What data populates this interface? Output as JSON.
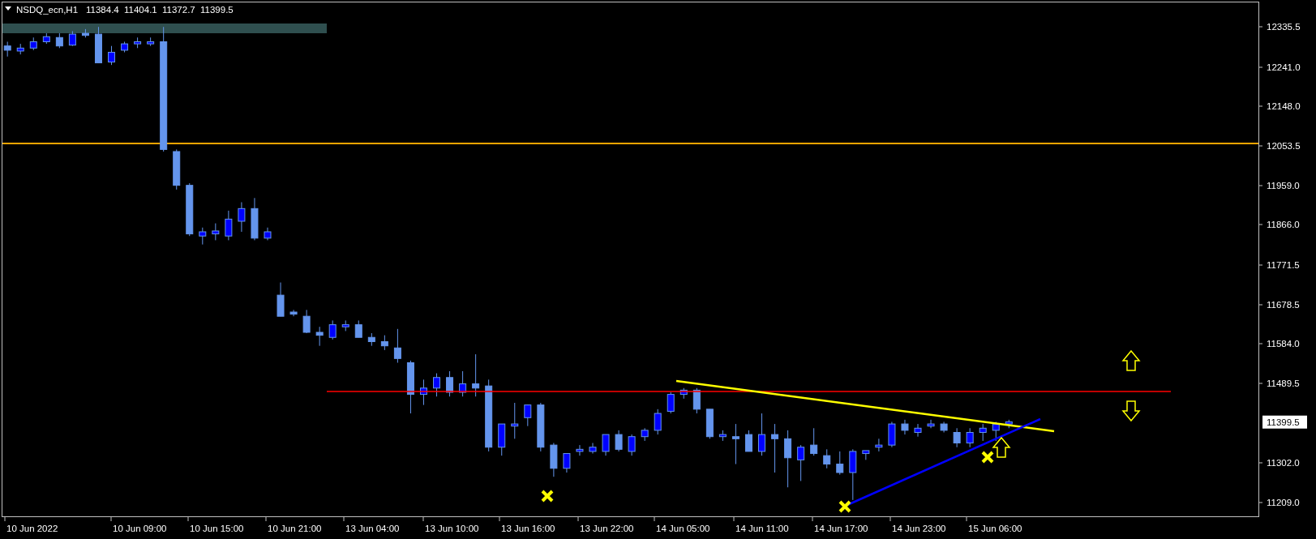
{
  "chart_header": {
    "symbol": "NSDQ_ecn,H1",
    "values": [
      "11384.4",
      "11404.1",
      "11372.7",
      "11399.5"
    ]
  },
  "price_axis": {
    "labels": [
      "12335.5",
      "12241.0",
      "12148.0",
      "12053.5",
      "11959.0",
      "11866.0",
      "11771.5",
      "11678.5",
      "11584.0",
      "11489.5",
      "11302.0",
      "11209.0"
    ],
    "current_price": "11399.5"
  },
  "time_axis": {
    "labels": [
      "10 Jun 2022",
      "10 Jun 09:00",
      "10 Jun 15:00",
      "10 Jun 21:00",
      "13 Jun 04:00",
      "13 Jun 10:00",
      "13 Jun 16:00",
      "13 Jun 22:00",
      "14 Jun 05:00",
      "14 Jun 11:00",
      "14 Jun 17:00",
      "14 Jun 23:00",
      "15 Jun 06:00"
    ]
  }
}
